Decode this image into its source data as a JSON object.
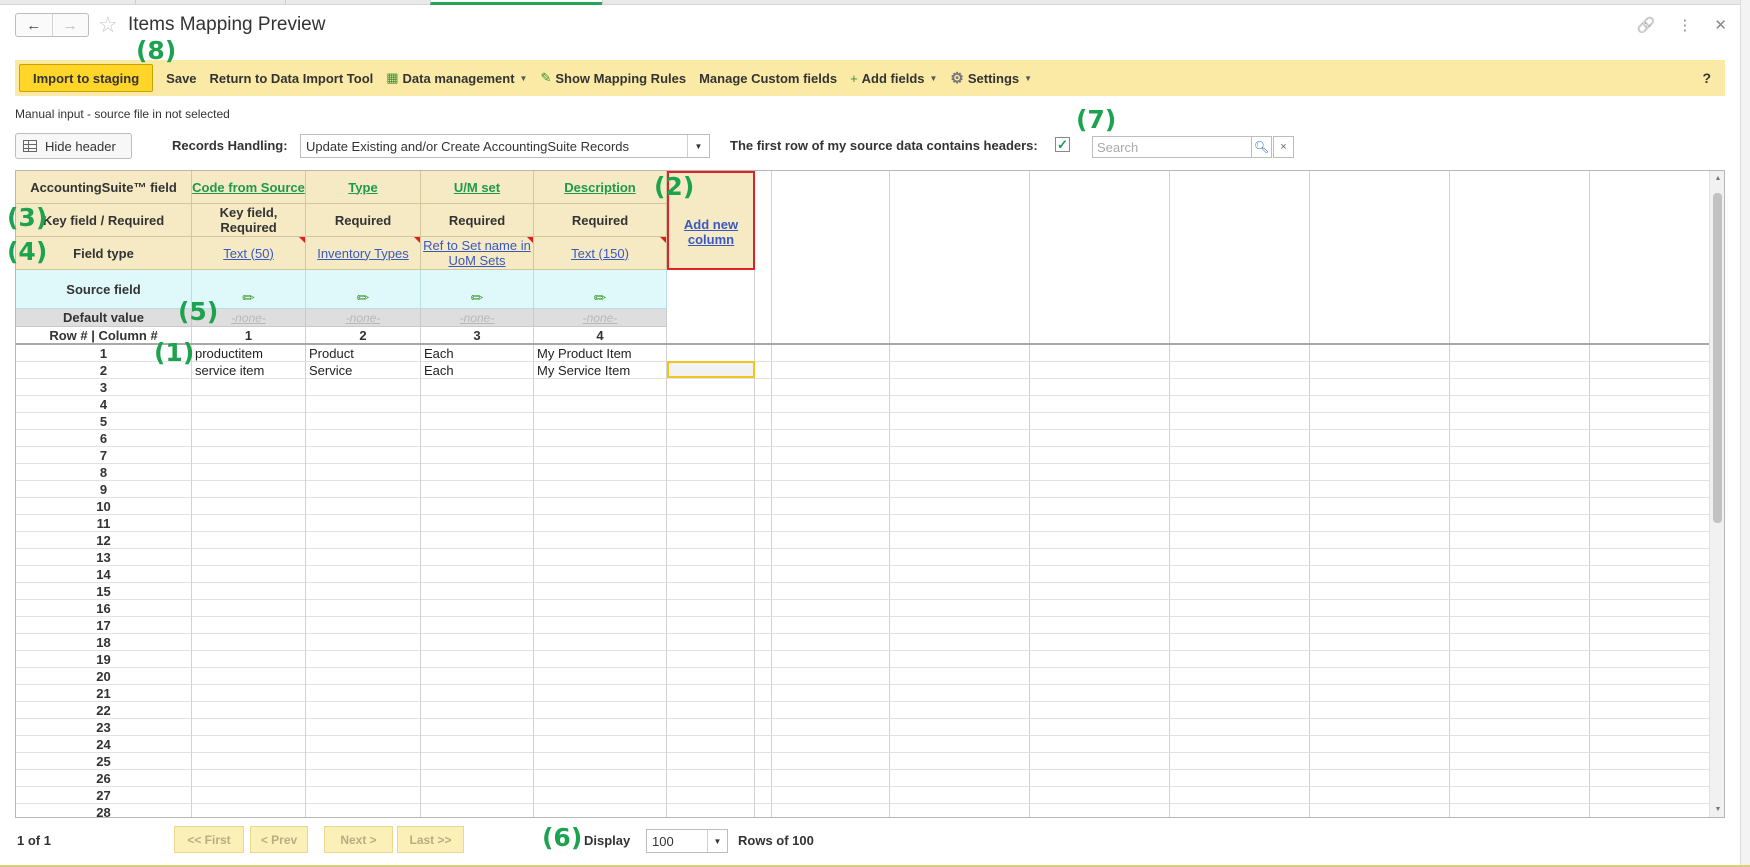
{
  "window": {
    "title": "Items Mapping Preview",
    "back_icon": "←",
    "forward_icon": "→",
    "star_icon": "☆",
    "link_icon": "🔗",
    "more_icon": "⋮",
    "close_icon": "✕"
  },
  "toolbar": {
    "import_label": "Import to staging",
    "save_label": "Save",
    "return_label": "Return to Data Import Tool",
    "data_mgmt_label": "Data management",
    "show_rules_label": "Show Mapping Rules",
    "custom_fields_label": "Manage Custom fields",
    "add_fields_label": "Add fields",
    "settings_label": "Settings",
    "help_label": "?",
    "accent_color": "#ffd52a",
    "bar_color": "#faeaa5"
  },
  "status": {
    "manual_input": "Manual input - source file in not selected"
  },
  "options": {
    "hide_header_label": "Hide header",
    "records_handling_label": "Records Handling:",
    "records_handling_value": "Update Existing and/or Create AccountingSuite Records",
    "first_row_label": "The first row of my source data contains headers:",
    "first_row_checked": true,
    "search_placeholder": "Search",
    "clear_label": "×"
  },
  "grid": {
    "row_labels": {
      "field": "AccountingSuite™ field",
      "key": "Key field / Required",
      "type": "Field type",
      "source": "Source field",
      "default": "Default value",
      "rowcol": "Row # | Column #"
    },
    "columns": [
      {
        "field": "Code from Source",
        "requirement": "Key field, Required",
        "field_type": "Text (50)",
        "default": "-none-",
        "number": "1"
      },
      {
        "field": "Type",
        "requirement": "Required",
        "field_type": "Inventory Types",
        "default": "-none-",
        "number": "2"
      },
      {
        "field": "U/M set",
        "requirement": "Required",
        "field_type": "Ref to Set name in UoM Sets",
        "default": "-none-",
        "number": "3"
      },
      {
        "field": "Description",
        "requirement": "Required",
        "field_type": "Text (150)",
        "default": "-none-",
        "number": "4"
      }
    ],
    "add_column_label": "Add new column",
    "rows": [
      [
        "productitem",
        "Product",
        "Each",
        "My Product Item"
      ],
      [
        "service item",
        "Service",
        "Each",
        "My Service Item"
      ]
    ],
    "row_numbers": [
      "1",
      "2",
      "3",
      "4",
      "5",
      "6",
      "7",
      "8",
      "9",
      "10",
      "11",
      "12",
      "13",
      "14",
      "15",
      "16",
      "17",
      "18",
      "19",
      "20",
      "21",
      "22",
      "23",
      "24",
      "25",
      "26",
      "27",
      "28"
    ]
  },
  "annotations": [
    "(1)",
    "(2)",
    "(3)",
    "(4)",
    "(5)",
    "(6)",
    "(7)",
    "(8)"
  ],
  "pager": {
    "info": "1 of 1",
    "first_label": "<< First",
    "prev_label": "< Prev",
    "next_label": "Next >",
    "last_label": "Last >>",
    "display_label": "Display",
    "display_value": "100",
    "rows_of_label": "Rows of 100"
  }
}
